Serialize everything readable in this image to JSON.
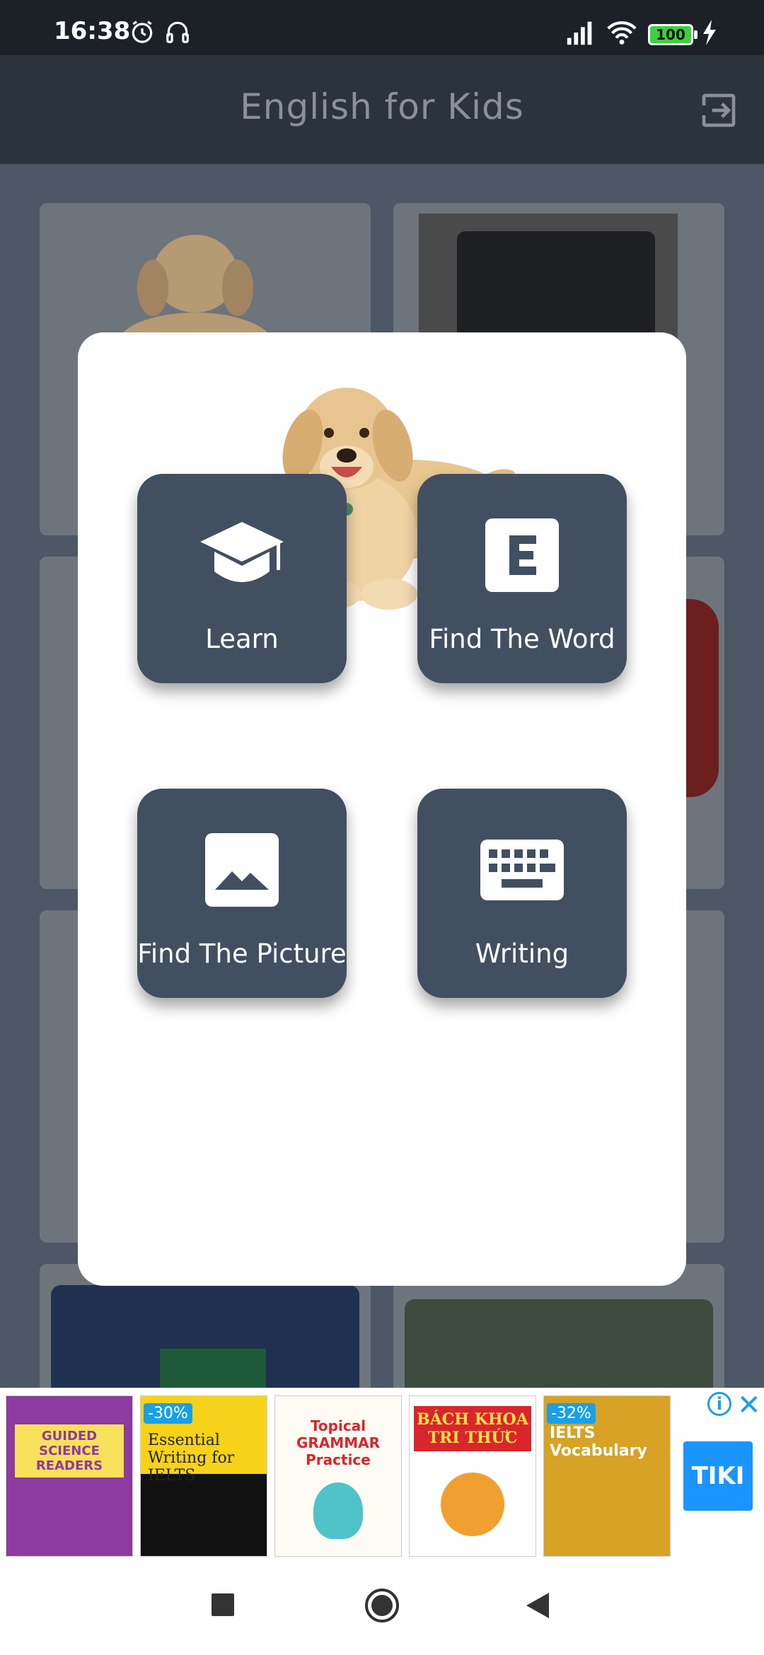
{
  "status_bar": {
    "time": "16:38",
    "battery": "100",
    "icons": [
      "alarm-icon",
      "headset-icon",
      "signal-icon",
      "wifi-icon",
      "battery-icon",
      "charging-icon"
    ]
  },
  "app_bar": {
    "title": "English for Kids",
    "exit_icon": "exit-icon"
  },
  "dialog": {
    "image": "dog",
    "options": [
      {
        "label": "Learn",
        "icon": "graduation-cap-icon"
      },
      {
        "label": "Find The Word",
        "icon": "letter-e-icon"
      },
      {
        "label": "Find The Picture",
        "icon": "image-icon"
      },
      {
        "label": "Writing",
        "icon": "keyboard-icon"
      }
    ]
  },
  "ads": {
    "books": [
      {
        "title": "GUIDED SCIENCE READERS",
        "discount": ""
      },
      {
        "title": "Essential Writing for IELTS",
        "discount": "-30%"
      },
      {
        "title": "Topical GRAMMAR Practice",
        "discount": ""
      },
      {
        "title": "BÁCH KHOA TRI THỨC",
        "discount": ""
      },
      {
        "title": "IELTS Vocabulary",
        "discount": "-32%"
      }
    ],
    "brand": "TIKI"
  },
  "colors": {
    "tile": "#424f60",
    "app_bar": "#2b333d",
    "ad_accent": "#1aa0e6"
  }
}
